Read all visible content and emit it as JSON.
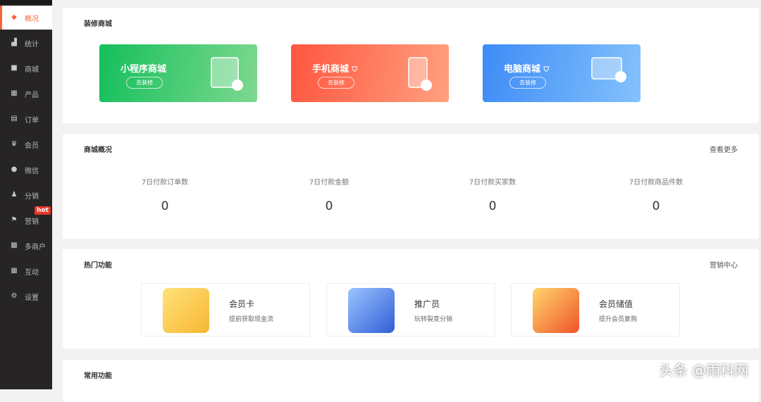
{
  "sidebar": {
    "items": [
      {
        "label": "概况",
        "icon": "layers-icon"
      },
      {
        "label": "统计",
        "icon": "chart-icon"
      },
      {
        "label": "商城",
        "icon": "mail-icon"
      },
      {
        "label": "产品",
        "icon": "grid-icon"
      },
      {
        "label": "订单",
        "icon": "clipboard-icon"
      },
      {
        "label": "会员",
        "icon": "crown-icon"
      },
      {
        "label": "微信",
        "icon": "wechat-icon"
      },
      {
        "label": "分销",
        "icon": "users-icon"
      },
      {
        "label": "营销",
        "icon": "flag-icon"
      },
      {
        "label": "多商户",
        "icon": "store-icon"
      },
      {
        "label": "互动",
        "icon": "grid-icon"
      },
      {
        "label": "设置",
        "icon": "gear-icon"
      }
    ],
    "hot_badge": "hot"
  },
  "decorate": {
    "title": "装修商城",
    "shops": [
      {
        "name": "小程序商城",
        "button": "去装修",
        "color": "#1dc263"
      },
      {
        "name": "手机商城",
        "button": "去装修",
        "color": "#ff5d45"
      },
      {
        "name": "电脑商城",
        "button": "去装修",
        "color": "#3f8ff7"
      }
    ]
  },
  "overview": {
    "title": "商城概况",
    "more": "查看更多",
    "stats": [
      {
        "label": "7日付款订单数",
        "value": "0"
      },
      {
        "label": "7日付款金额",
        "value": "0"
      },
      {
        "label": "7日付款买家数",
        "value": "0"
      },
      {
        "label": "7日付款商品件数",
        "value": "0"
      }
    ]
  },
  "hot": {
    "title": "热门功能",
    "more": "营销中心",
    "features": [
      {
        "name": "会员卡",
        "desc": "提前获取现金流"
      },
      {
        "name": "推广员",
        "desc": "玩转裂变分销"
      },
      {
        "name": "会员储值",
        "desc": "提升会员复购"
      }
    ]
  },
  "common": {
    "title": "常用功能"
  },
  "watermark": "头条 @雨科网"
}
